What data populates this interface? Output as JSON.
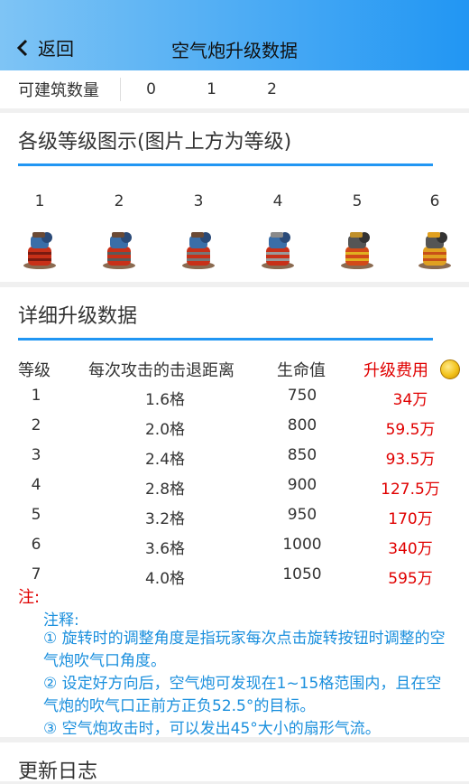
{
  "header": {
    "back_label": "返回",
    "title": "空气炮升级数据"
  },
  "build_count": {
    "label": "可建筑数量",
    "values": [
      "0",
      "1",
      "2"
    ]
  },
  "images_section": {
    "title": "各级等级图示(图片上方为等级)",
    "levels": [
      "1",
      "2",
      "3",
      "4",
      "5",
      "6"
    ]
  },
  "details_section": {
    "title": "详细升级数据",
    "columns": [
      "等级",
      "每次攻击的击退距离",
      "生命值",
      "升级费用"
    ],
    "rows": [
      [
        "1",
        "1.6格",
        "750",
        "34万"
      ],
      [
        "2",
        "2.0格",
        "800",
        "59.5万"
      ],
      [
        "3",
        "2.4格",
        "850",
        "93.5万"
      ],
      [
        "4",
        "2.8格",
        "900",
        "127.5万"
      ],
      [
        "5",
        "3.2格",
        "950",
        "170万"
      ],
      [
        "6",
        "3.6格",
        "1000",
        "340万"
      ],
      [
        "7",
        "4.0格",
        "1050",
        "595万"
      ]
    ]
  },
  "notes": {
    "label": "注:",
    "heading": "注释:",
    "items": [
      "① 旋转时的调整角度是指玩家每次点击旋转按钮时调整的空气炮吹气口角度。",
      "② 设定好方向后，空气炮可发现在1~15格范围内，且在空气炮的吹气口正前方正负52.5°的目标。",
      "③ 空气炮攻击时，可以发出45°大小的扇形气流。"
    ]
  },
  "update_section": {
    "title": "更新日志"
  },
  "colors": {
    "accent": "#2196f3",
    "fee": "#e00000",
    "note": "#1a8fdd"
  }
}
